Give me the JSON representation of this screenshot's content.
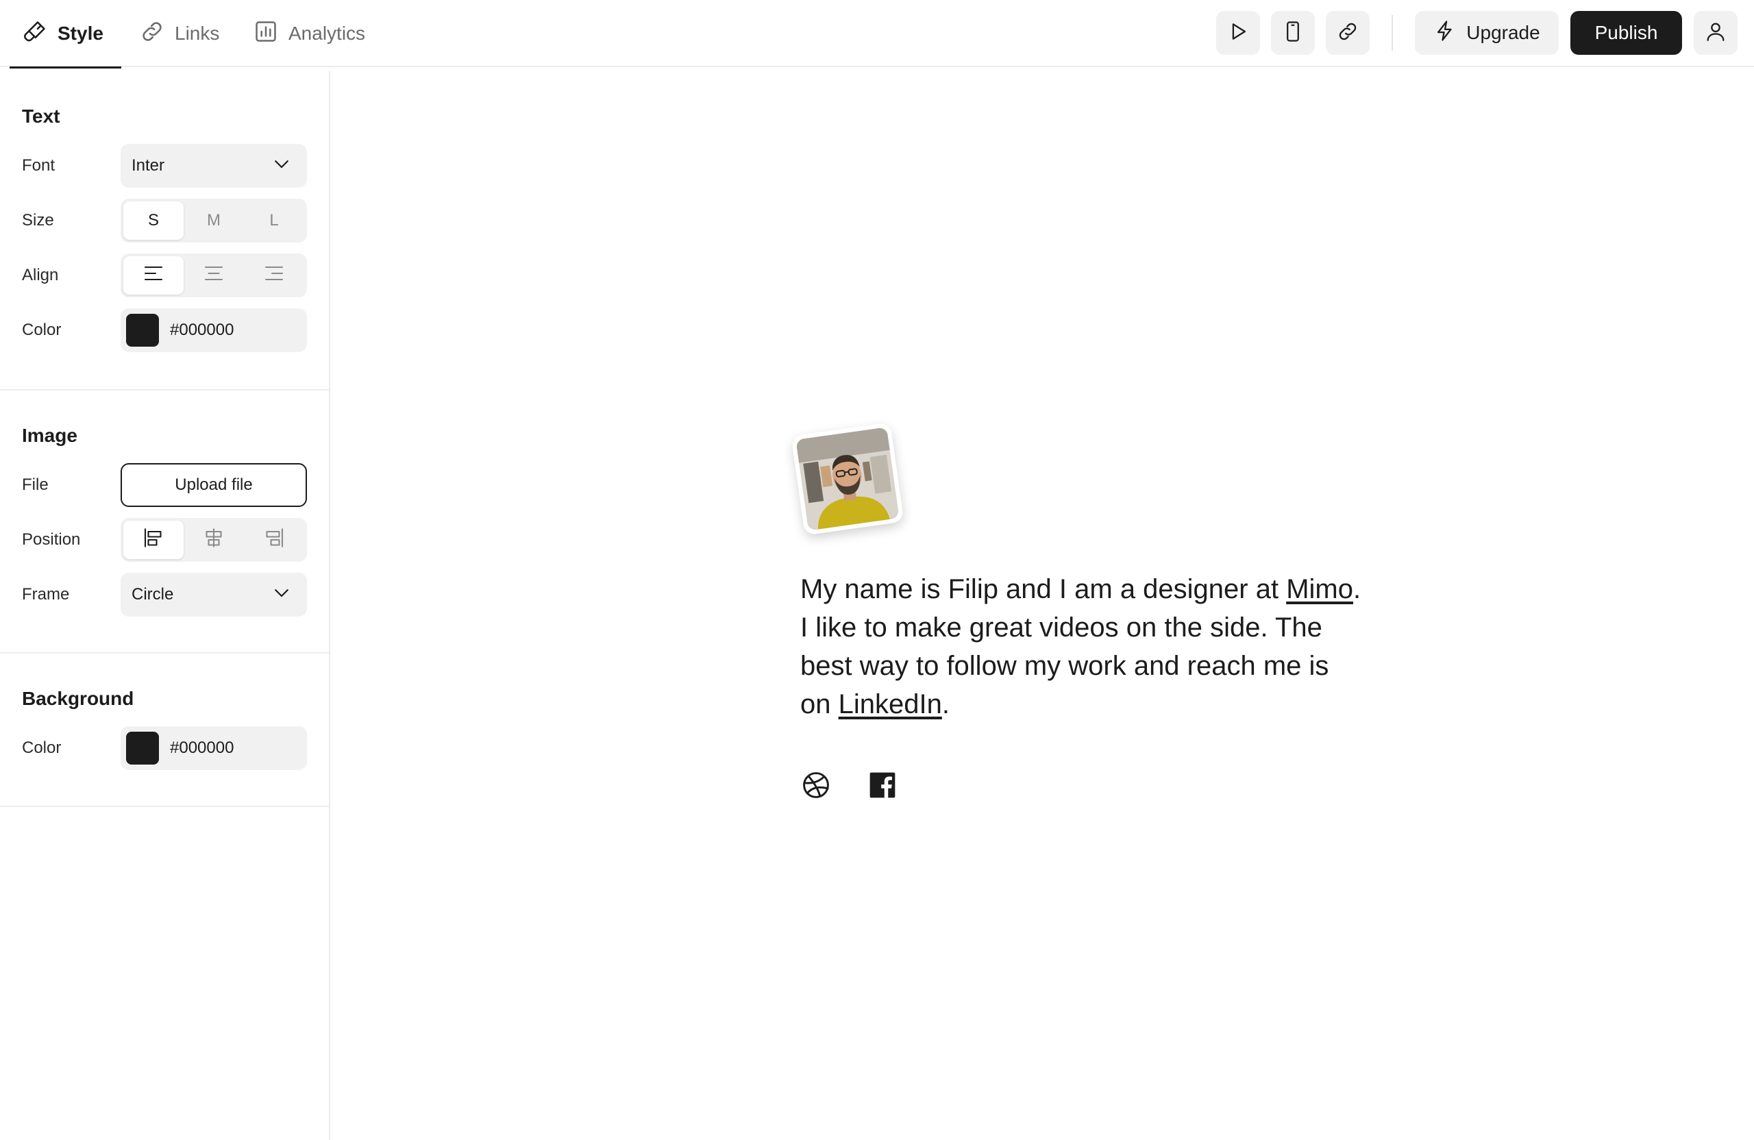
{
  "tabs": [
    {
      "label": "Style",
      "icon": "brush-icon",
      "active": true
    },
    {
      "label": "Links",
      "icon": "link-icon",
      "active": false
    },
    {
      "label": "Analytics",
      "icon": "bar-chart-icon",
      "active": false
    }
  ],
  "toolbar": {
    "preview_icon": "play-icon",
    "mobile_icon": "phone-icon",
    "share_icon": "link-icon",
    "upgrade_label": "Upgrade",
    "publish_label": "Publish",
    "account_icon": "user-icon"
  },
  "sidebar": {
    "text": {
      "heading": "Text",
      "font_label": "Font",
      "font_value": "Inter",
      "size_label": "Size",
      "size_options": [
        "S",
        "M",
        "L"
      ],
      "size_selected": "S",
      "align_label": "Align",
      "align_options": [
        "align-left-icon",
        "align-center-icon",
        "align-right-icon"
      ],
      "align_selected": "left",
      "color_label": "Color",
      "color_value": "#000000"
    },
    "image": {
      "heading": "Image",
      "file_label": "File",
      "upload_label": "Upload file",
      "position_label": "Position",
      "position_options": [
        "position-left-icon",
        "position-center-icon",
        "position-right-icon"
      ],
      "position_selected": "left",
      "frame_label": "Frame",
      "frame_value": "Circle"
    },
    "background": {
      "heading": "Background",
      "color_label": "Color",
      "color_value": "#000000"
    }
  },
  "preview": {
    "bio_part1": "My name is Filip and I am a designer at ",
    "bio_link1": "Mimo",
    "bio_part2": ". I like to make great videos on the side. The best way to follow my work and reach me is on ",
    "bio_link2": "LinkedIn",
    "bio_part3": ".",
    "socials": [
      "dribbble-icon",
      "facebook-icon"
    ]
  },
  "colors": {
    "accent": "#1c1c1c",
    "control_bg": "#f1f1f1",
    "border": "#ececec"
  }
}
